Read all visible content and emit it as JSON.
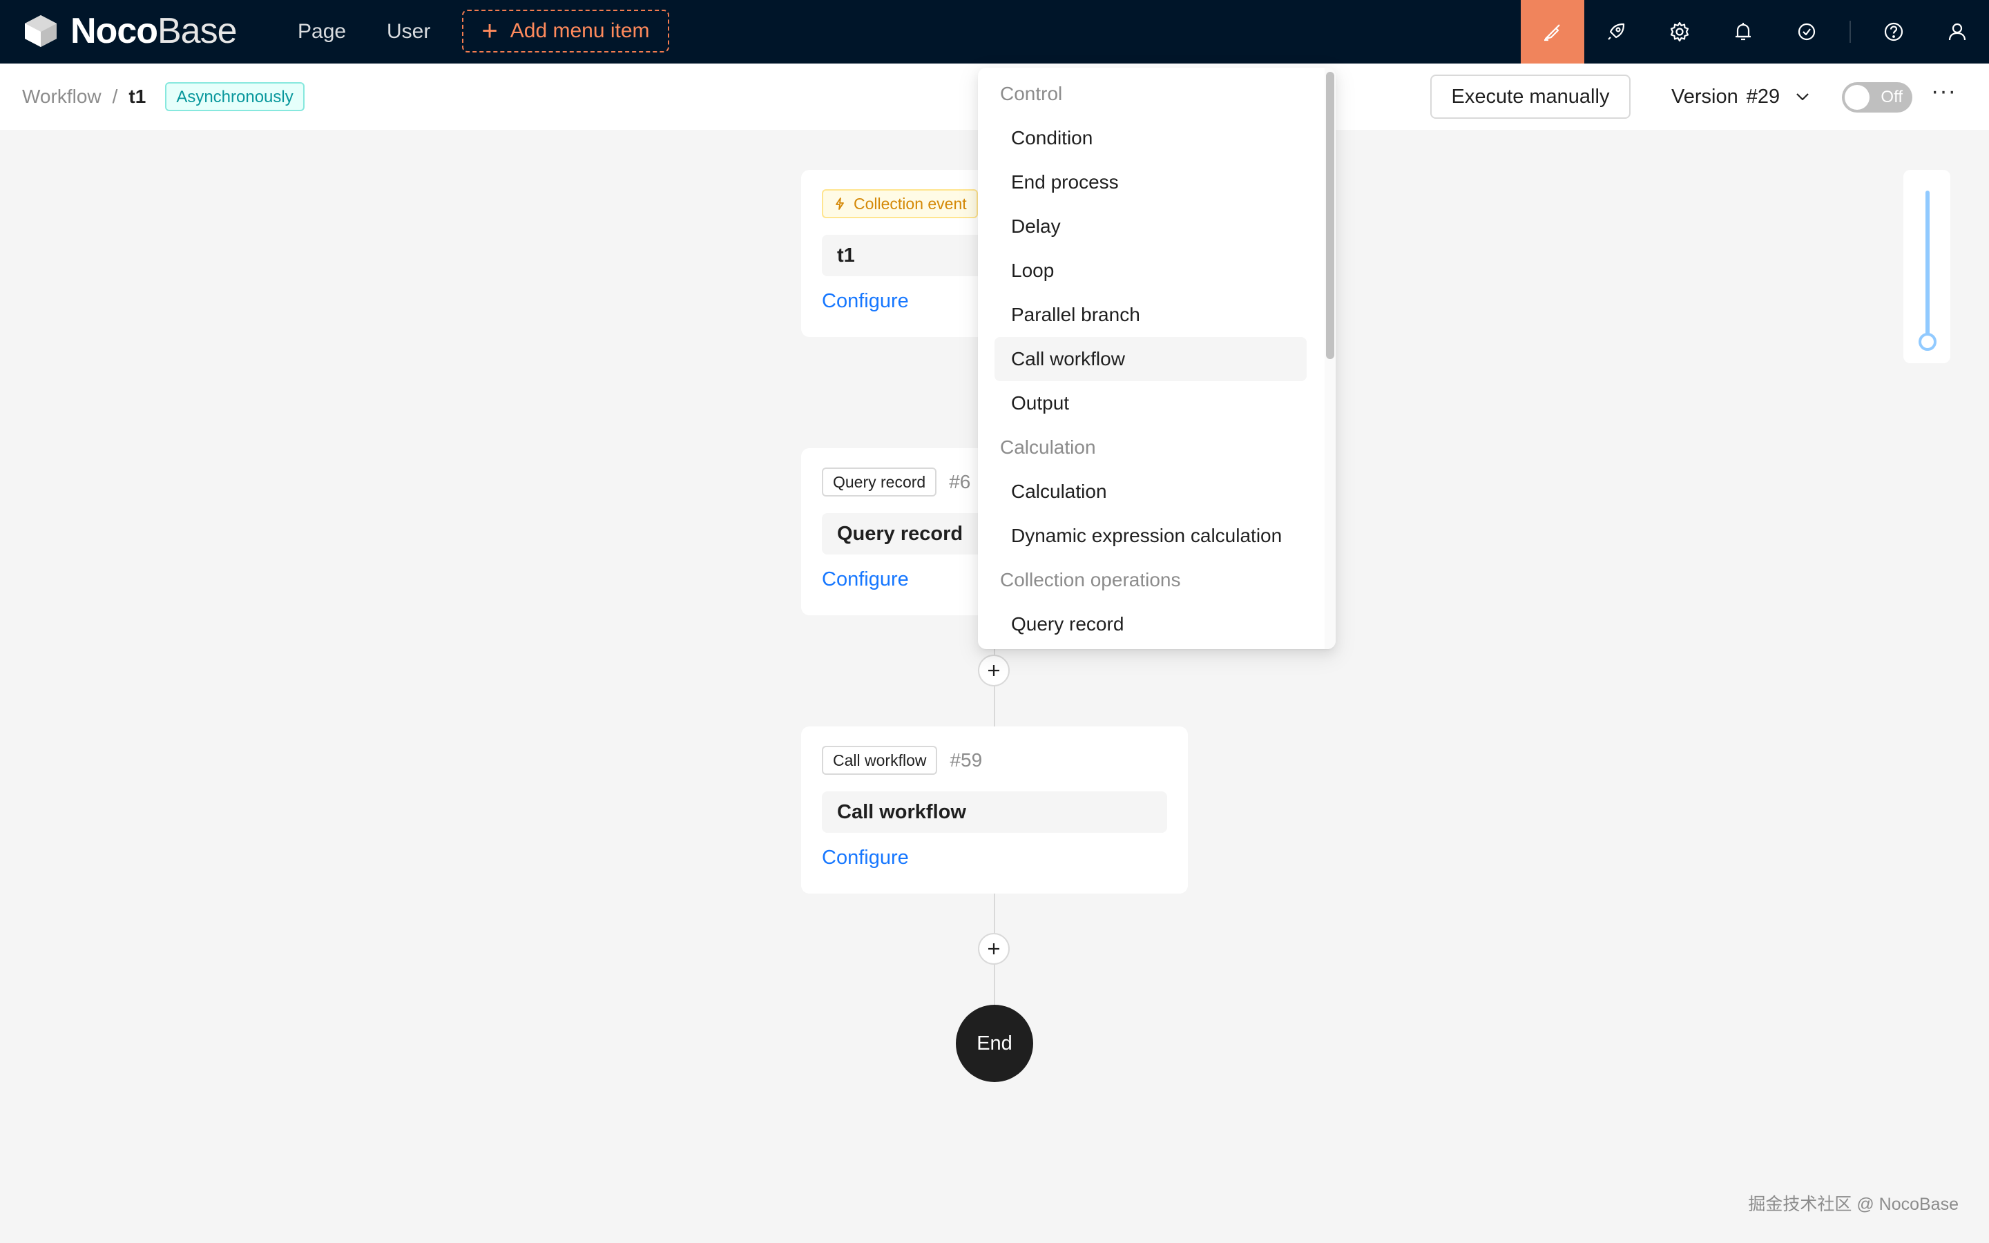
{
  "app": {
    "logo": {
      "bold": "Noco",
      "light": "Base"
    },
    "nav": [
      "Page",
      "User"
    ],
    "add_menu_label": "Add menu item",
    "accent_color": "#f0845c",
    "topbar_icons": [
      "workflow-paint-icon",
      "plugin-rocket-icon",
      "settings-gear-icon",
      "notification-bell-icon",
      "tasks-check-icon",
      "help-question-icon",
      "user-profile-icon"
    ]
  },
  "header": {
    "breadcrumb": {
      "parent": "Workflow",
      "separator": "/",
      "current": "t1"
    },
    "mode_tag": "Asynchronously",
    "execute_label": "Execute manually",
    "version_label": "Version",
    "version_value": "#29",
    "toggle_label": "Off",
    "more_label": "···"
  },
  "canvas": {
    "trigger": {
      "tag": "Collection event",
      "title": "t1",
      "configure": "Configure"
    },
    "nodes": [
      {
        "tag": "Query record",
        "id": "#6",
        "title": "Query record",
        "configure": "Configure"
      },
      {
        "tag": "Call workflow",
        "id": "#59",
        "title": "Call workflow",
        "configure": "Configure"
      }
    ],
    "end_label": "End",
    "zoom_level": 1.0
  },
  "dropdown": {
    "groups": [
      {
        "label": "Control",
        "items": [
          "Condition",
          "End process",
          "Delay",
          "Loop",
          "Parallel branch",
          "Call workflow",
          "Output"
        ]
      },
      {
        "label": "Calculation",
        "items": [
          "Calculation",
          "Dynamic expression calculation"
        ]
      },
      {
        "label": "Collection operations",
        "items": [
          "Query record"
        ]
      }
    ],
    "hovered_item": "Call workflow"
  },
  "watermark": "掘金技术社区 @ NocoBase"
}
